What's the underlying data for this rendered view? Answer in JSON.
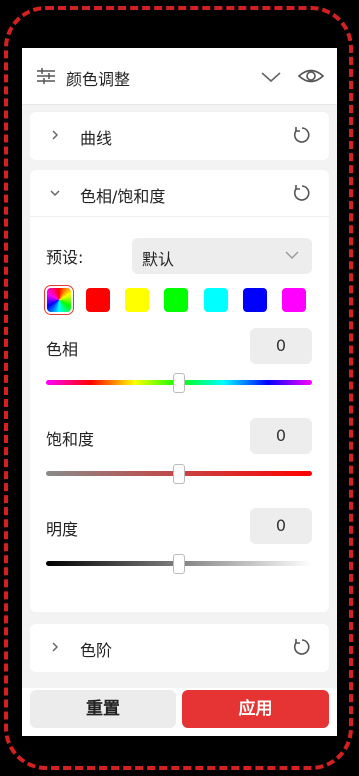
{
  "header": {
    "title": "颜色调整"
  },
  "sections": {
    "curves": {
      "title": "曲线"
    },
    "hsl": {
      "title": "色相/饱和度",
      "preset_label": "预设:",
      "preset_value": "默认",
      "swatches": [
        "rainbow",
        "#ff0000",
        "#ffff00",
        "#00ff00",
        "#00ffff",
        "#0000ff",
        "#ff00ff"
      ],
      "hue": {
        "label": "色相",
        "value": "0"
      },
      "saturation": {
        "label": "饱和度",
        "value": "0"
      },
      "lightness": {
        "label": "明度",
        "value": "0"
      }
    },
    "levels": {
      "title": "色阶"
    }
  },
  "footer": {
    "reset_label": "重置",
    "apply_label": "应用"
  },
  "colors": {
    "accent": "#e63333",
    "frame": "#d62020"
  }
}
